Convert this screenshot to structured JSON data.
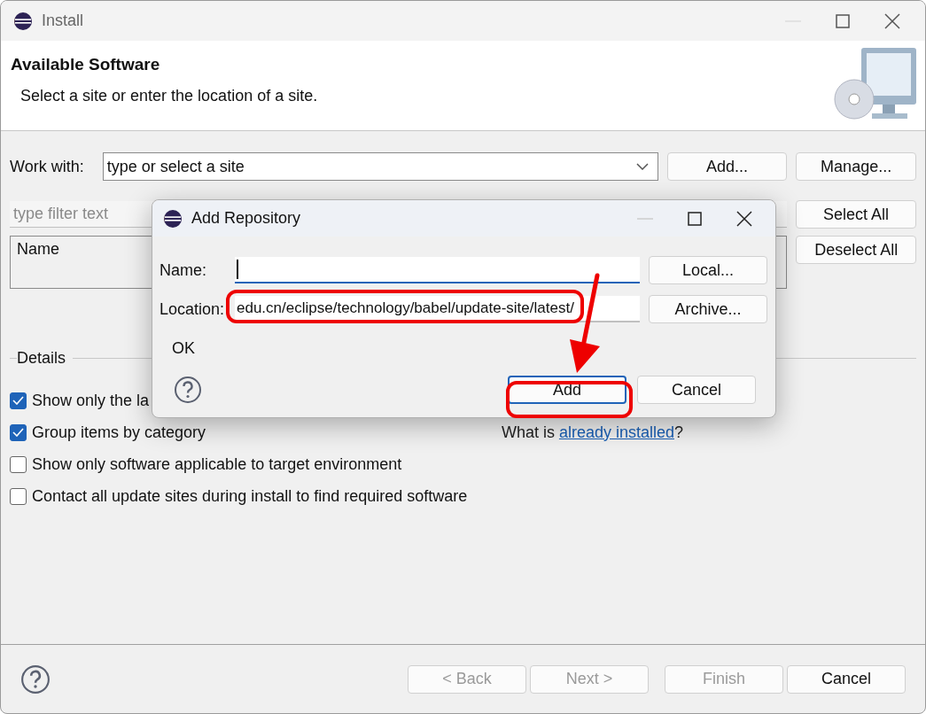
{
  "window": {
    "title": "Install"
  },
  "header": {
    "title": "Available Software",
    "description": "Select a site or enter the location of a site."
  },
  "work_with": {
    "label": "Work with:",
    "value": "type or select a site",
    "buttons": [
      "Add...",
      "Manage..."
    ]
  },
  "filter": {
    "placeholder": "type filter text"
  },
  "selection_buttons": [
    "Select All",
    "Deselect All"
  ],
  "table": {
    "columns": [
      {
        "label": "Name"
      }
    ]
  },
  "details": {
    "label": "Details"
  },
  "options": [
    {
      "label": "Show only the la",
      "checked": true
    },
    {
      "label": "Group items by category",
      "checked": true
    },
    {
      "label": "Show only software applicable to target environment",
      "checked": false
    },
    {
      "label": "Contact all update sites during install to find required software",
      "checked": false
    }
  ],
  "installed_note": {
    "prefix": "What is ",
    "link": "already installed",
    "suffix": "?"
  },
  "footer_buttons": [
    {
      "label": "< Back",
      "disabled": true
    },
    {
      "label": "Next >",
      "disabled": true
    },
    {
      "label": "Finish",
      "disabled": true
    },
    {
      "label": "Cancel",
      "disabled": false
    }
  ],
  "dialog": {
    "title": "Add Repository",
    "fields": [
      {
        "label": "Name:",
        "focused": true,
        "button": "Local..."
      },
      {
        "label": "Location:",
        "value": "edu.cn/eclipse/technology/babel/update-site/latest/",
        "focused": false,
        "button": "Archive..."
      }
    ],
    "status": "OK",
    "buttons": [
      {
        "label": "Add",
        "default": true
      },
      {
        "label": "Cancel",
        "default": false
      }
    ]
  }
}
